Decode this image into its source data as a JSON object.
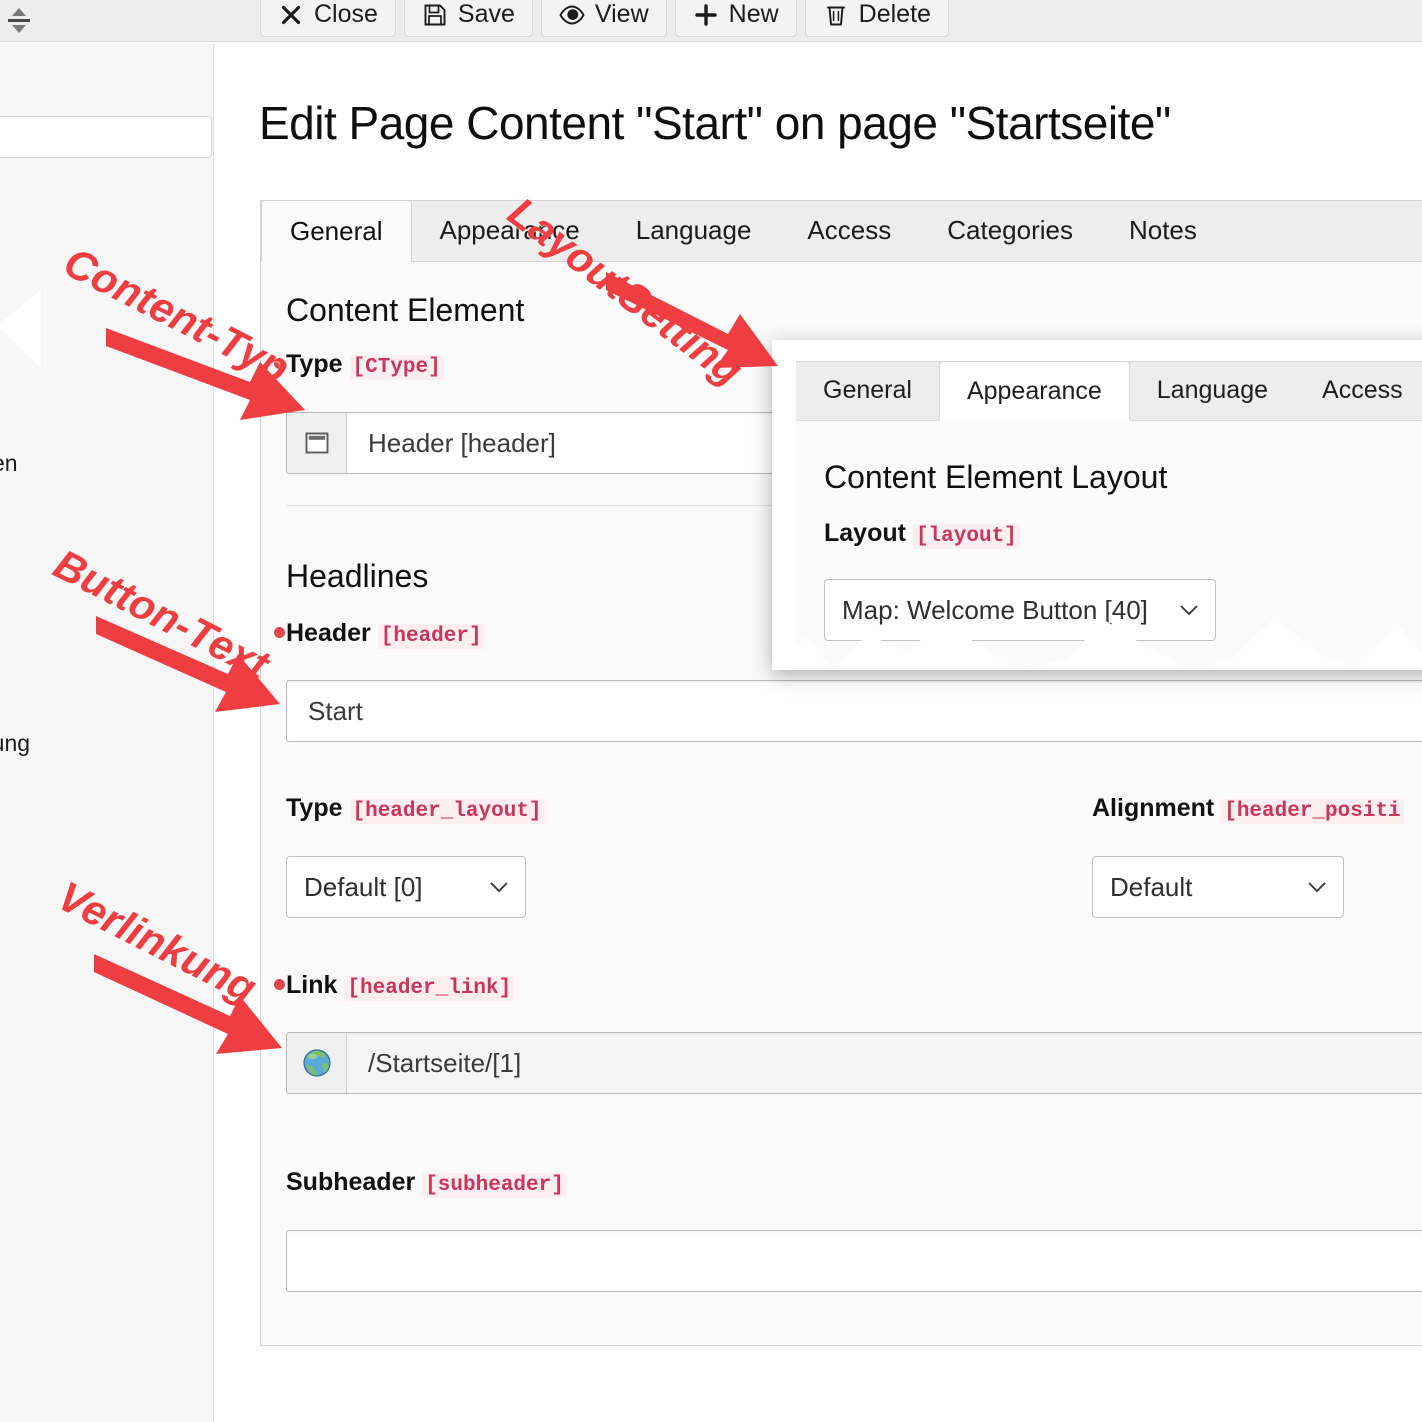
{
  "toolbar": {
    "buttons": [
      {
        "label": "Close",
        "icon": "close-icon"
      },
      {
        "label": "Save",
        "icon": "save-icon"
      },
      {
        "label": "View",
        "icon": "eye-icon"
      },
      {
        "label": "New",
        "icon": "plus-icon"
      },
      {
        "label": "Delete",
        "icon": "trash-icon"
      }
    ]
  },
  "sidebar": {
    "search_value": "",
    "search_placeholder": "",
    "menu_fragments": [
      "en",
      "rung"
    ]
  },
  "page_title": "Edit Page Content \"Start\" on page \"Startseite\"",
  "main_tabs": [
    {
      "label": "General",
      "active": true
    },
    {
      "label": "Appearance",
      "active": false
    },
    {
      "label": "Language",
      "active": false
    },
    {
      "label": "Access",
      "active": false
    },
    {
      "label": "Categories",
      "active": false
    },
    {
      "label": "Notes",
      "active": false
    }
  ],
  "sections": {
    "content_element": {
      "title": "Content Element",
      "type_field": {
        "label": "Type",
        "code": "[CType]",
        "value": "Header [header]",
        "icon": "content-header-icon"
      }
    },
    "headlines": {
      "title": "Headlines",
      "header_field": {
        "label": "Header",
        "code": "[header]",
        "value": "Start"
      },
      "type_field": {
        "label": "Type",
        "code": "[header_layout]",
        "value": "Default [0]"
      },
      "alignment_field": {
        "label": "Alignment",
        "code": "[header_positi",
        "value": "Default"
      },
      "link_field": {
        "label": "Link",
        "code": "[header_link]",
        "value": "/Startseite/[1]",
        "icon": "globe-icon"
      },
      "subheader_field": {
        "label": "Subheader",
        "code": "[subheader]",
        "value": ""
      }
    }
  },
  "callout": {
    "tabs": [
      {
        "label": "General",
        "active": false
      },
      {
        "label": "Appearance",
        "active": true
      },
      {
        "label": "Language",
        "active": false
      },
      {
        "label": "Access",
        "active": false
      }
    ],
    "title": "Content Element Layout",
    "layout_field": {
      "label": "Layout",
      "code": "[layout]",
      "value": "Map: Welcome Button [40]"
    }
  },
  "annotations": [
    {
      "text": "Content-Typ",
      "name": "annotation-content-typ"
    },
    {
      "text": "LayoutSetting",
      "name": "annotation-layout-setting"
    },
    {
      "text": "Button-Text",
      "name": "annotation-button-text"
    },
    {
      "text": "Verlinkung",
      "name": "annotation-verlinkung"
    }
  ],
  "colors": {
    "annotation_red": "#ef3e42",
    "code_pink": "#c9365a",
    "required_dot": "#e0484b"
  }
}
